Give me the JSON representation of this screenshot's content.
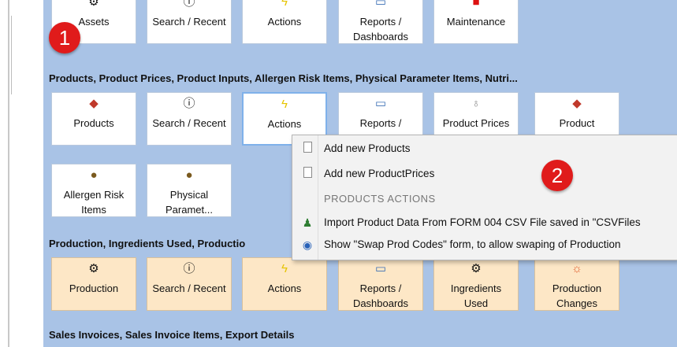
{
  "row1": {
    "tiles": [
      {
        "label": "Assets",
        "icon": "gear-head-icon"
      },
      {
        "label": "Search / Recent",
        "icon": "info-icon"
      },
      {
        "label": "Actions",
        "icon": "lightning-icon"
      },
      {
        "label": "Reports / Dashboards",
        "icon": "printer-icon"
      },
      {
        "label": "Maintenance",
        "icon": "toolbox-icon"
      }
    ]
  },
  "section_products": "Products,  Product Prices,  Product Inputs,  Allergen Risk Items,  Physical Parameter Items,  Nutri...",
  "products": {
    "tiles": [
      {
        "label": "Products",
        "icon": "shapes-icon"
      },
      {
        "label": "Search / Recent",
        "icon": "info-icon"
      },
      {
        "label": "Actions",
        "icon": "lightning-icon"
      },
      {
        "label": "Reports /",
        "icon": "printer-icon"
      },
      {
        "label": "Product Prices",
        "icon": "money-bag-icon"
      },
      {
        "label": "Product",
        "icon": "shapes-icon"
      },
      {
        "label": "Allergen Risk Items",
        "icon": "nut-icon"
      },
      {
        "label": "Physical Paramet...",
        "icon": "nut-icon"
      }
    ]
  },
  "section_production": "Production,  Ingredients Used,  Productio",
  "production": {
    "tiles": [
      {
        "label": "Production",
        "icon": "gear-head-icon"
      },
      {
        "label": "Search / Recent",
        "icon": "info-icon"
      },
      {
        "label": "Actions",
        "icon": "lightning-icon"
      },
      {
        "label": "Reports / Dashboards",
        "icon": "printer-icon"
      },
      {
        "label": "Ingredients Used",
        "icon": "gear-head-icon"
      },
      {
        "label": "Production Changes",
        "icon": "sun-icon"
      }
    ]
  },
  "section_sales": "Sales Invoices,  Sales Invoice Items,  Export Details",
  "badges": {
    "one": "1",
    "two": "2"
  },
  "menu": {
    "item1": "Add new Products",
    "item2": "Add new ProductPrices",
    "header": "PRODUCTS  ACTIONS",
    "item3": "Import Product Data From FORM 004 CSV File saved in \"CSVFiles",
    "item4": "Show \"Swap Prod Codes\" form, to allow swaping of Production"
  },
  "colors": {
    "panel": "#a9c3e6",
    "tile": "#ffffff",
    "tile_orange": "#fde7c6",
    "badge": "#e01b1b",
    "menu_bg": "#f2f2f2"
  }
}
